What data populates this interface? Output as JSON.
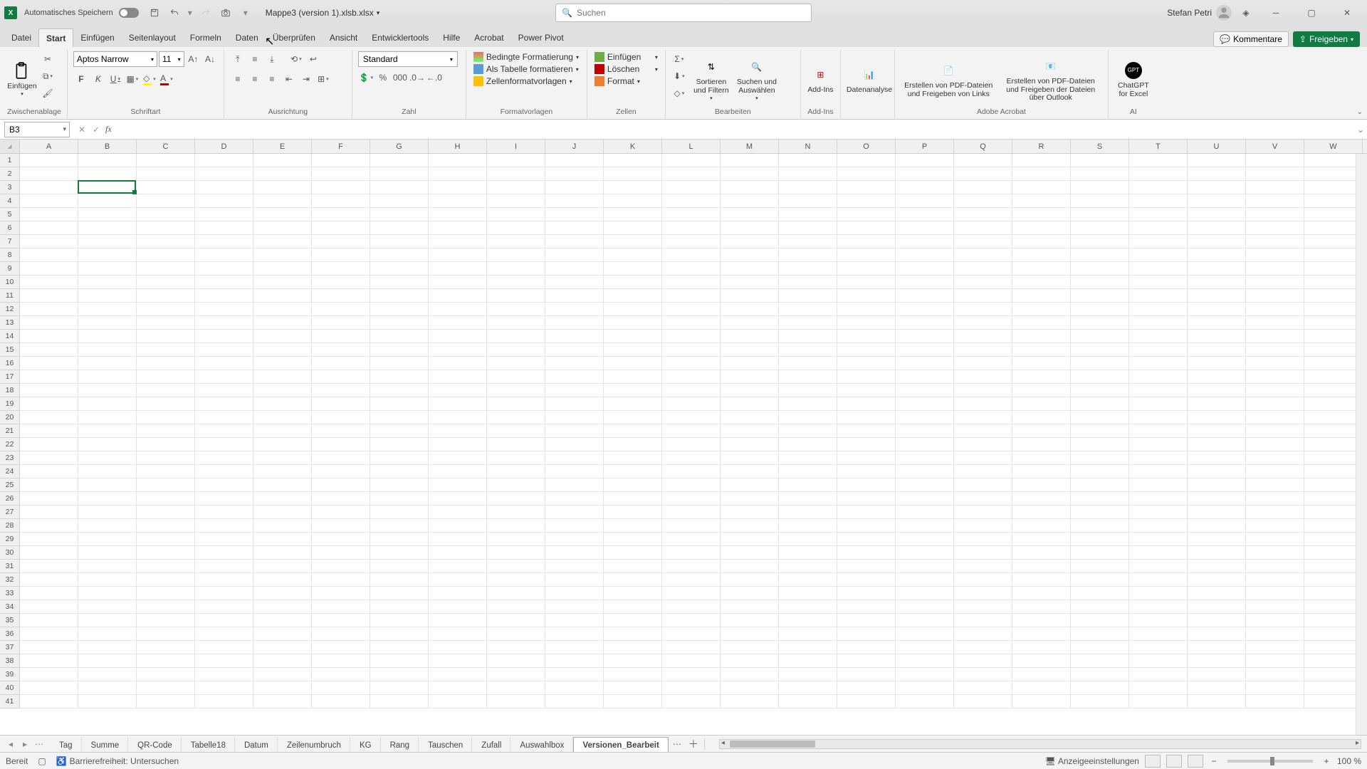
{
  "titlebar": {
    "autosave_label": "Automatisches Speichern",
    "filename": "Mappe3 (version 1).xlsb.xlsx",
    "search_placeholder": "Suchen",
    "username": "Stefan Petri"
  },
  "ribbon_tabs": [
    "Datei",
    "Start",
    "Einfügen",
    "Seitenlayout",
    "Formeln",
    "Daten",
    "Überprüfen",
    "Ansicht",
    "Entwicklertools",
    "Hilfe",
    "Acrobat",
    "Power Pivot"
  ],
  "ribbon_active": 1,
  "ribbon_right": {
    "comments": "Kommentare",
    "share": "Freigeben"
  },
  "groups": {
    "clipboard": {
      "paste": "Einfügen",
      "label": "Zwischenablage"
    },
    "font": {
      "name": "Aptos Narrow",
      "size": "11",
      "label": "Schriftart",
      "bold": "F",
      "italic": "K",
      "underline": "U"
    },
    "align": {
      "label": "Ausrichtung"
    },
    "number": {
      "format": "Standard",
      "label": "Zahl"
    },
    "styles": {
      "cond": "Bedingte Formatierung",
      "table": "Als Tabelle formatieren",
      "cell": "Zellenformatvorlagen",
      "label": "Formatvorlagen"
    },
    "cells": {
      "insert": "Einfügen",
      "delete": "Löschen",
      "format": "Format",
      "label": "Zellen"
    },
    "editing": {
      "sort": "Sortieren und Filtern",
      "find": "Suchen und Auswählen",
      "label": "Bearbeiten"
    },
    "addins": {
      "addins": "Add-Ins",
      "label": "Add-Ins"
    },
    "data": {
      "analysis": "Datenanalyse"
    },
    "acrobat": {
      "createlinks": "Erstellen von PDF-Dateien und Freigeben von Links",
      "createoutlook": "Erstellen von PDF-Dateien und Freigeben der Dateien über Outlook",
      "label": "Adobe Acrobat"
    },
    "ai": {
      "chatgpt": "ChatGPT for Excel",
      "label": "AI"
    }
  },
  "formula": {
    "cell_ref": "B3",
    "value": ""
  },
  "columns": [
    "A",
    "B",
    "C",
    "D",
    "E",
    "F",
    "G",
    "H",
    "I",
    "J",
    "K",
    "L",
    "M",
    "N",
    "O",
    "P",
    "Q",
    "R",
    "S",
    "T",
    "U",
    "V",
    "W"
  ],
  "row_count": 41,
  "active_cell": {
    "col": 1,
    "row": 2
  },
  "sheet_tabs": [
    "Tag",
    "Summe",
    "QR-Code",
    "Tabelle18",
    "Datum",
    "Zeilenumbruch",
    "KG",
    "Rang",
    "Tauschen",
    "Zufall",
    "Auswahlbox",
    "Versionen_Bearbeit"
  ],
  "sheet_active": 11,
  "status": {
    "ready": "Bereit",
    "access": "Barrierefreiheit: Untersuchen",
    "display": "Anzeigeeinstellungen",
    "zoom": "100 %"
  }
}
